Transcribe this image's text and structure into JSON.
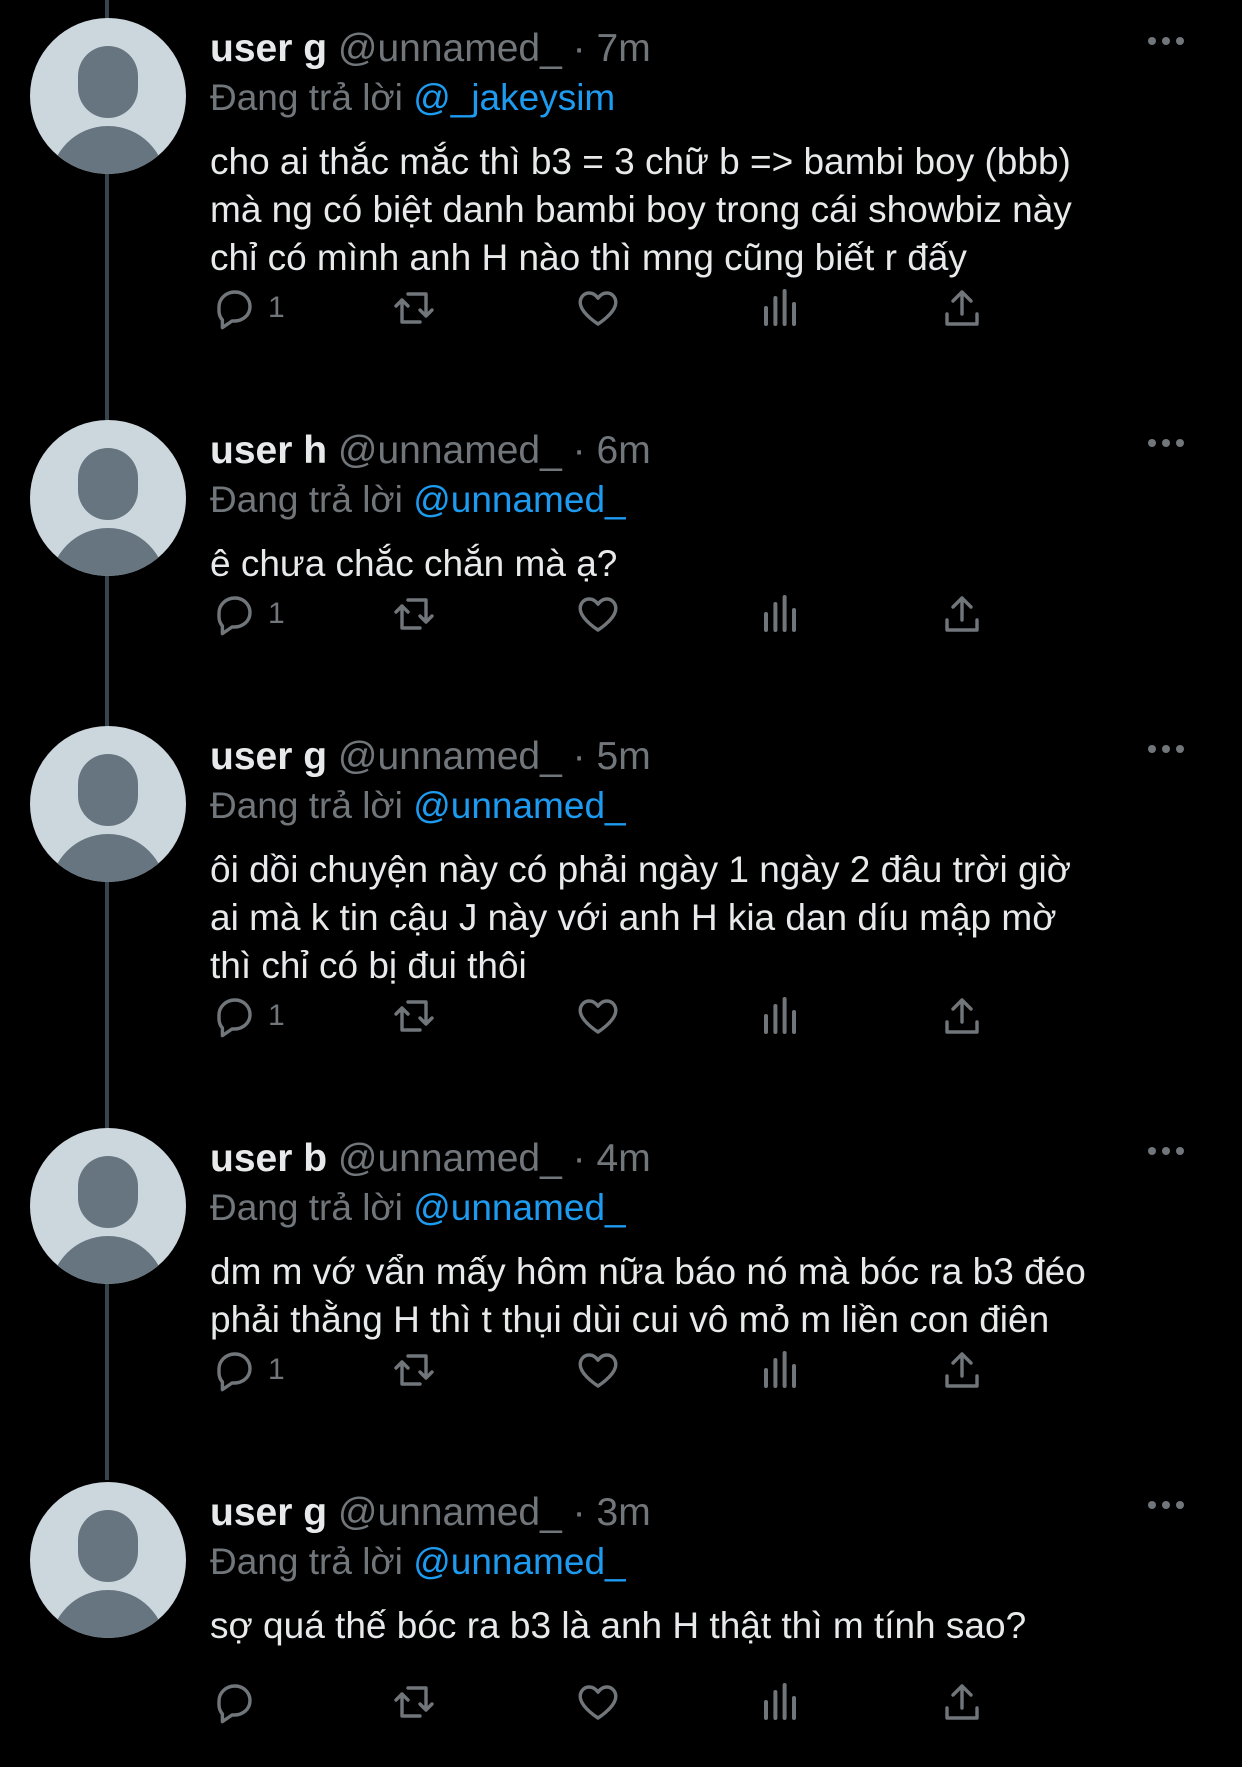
{
  "tweets": [
    {
      "name": "user g",
      "handle": "@unnamed_",
      "dot": "·",
      "time": "7m",
      "reply_prefix": "Đang trả lời",
      "reply_to": "@_jakeysim",
      "lines": [
        "cho ai thắc mắc thì b3 = 3 chữ b => bambi boy (bbb)",
        "mà ng có biệt danh bambi boy trong cái showbiz này",
        "chỉ có mình anh H nào thì mng cũng biết r đấy"
      ],
      "reply_count": "1"
    },
    {
      "name": "user h",
      "handle": "@unnamed_",
      "dot": "·",
      "time": "6m",
      "reply_prefix": "Đang trả lời",
      "reply_to": "@unnamed_",
      "lines": [
        "ê chưa chắc chắn mà ạ?"
      ],
      "reply_count": "1"
    },
    {
      "name": "user g",
      "handle": "@unnamed_",
      "dot": "·",
      "time": "5m",
      "reply_prefix": "Đang trả lời",
      "reply_to": "@unnamed_",
      "lines": [
        "ôi dồi chuyện này có phải ngày 1 ngày 2 đâu trời giờ",
        "ai mà k tin cậu J này với anh H kia dan díu mập mờ",
        "thì chỉ có bị đui thôi"
      ],
      "reply_count": "1"
    },
    {
      "name": "user b",
      "handle": "@unnamed_",
      "dot": "·",
      "time": "4m",
      "reply_prefix": "Đang trả lời",
      "reply_to": "@unnamed_",
      "lines": [
        "dm m vớ vẩn mấy hôm nữa báo nó mà bóc ra b3 đéo",
        "phải thằng H thì t thụi dùi cui vô mỏ m liền con điên"
      ],
      "reply_count": "1"
    },
    {
      "name": "user g",
      "handle": "@unnamed_",
      "dot": "·",
      "time": "3m",
      "reply_prefix": "Đang trả lời",
      "reply_to": "@unnamed_",
      "lines": [
        "sợ quá thế bóc ra b3 là anh H thật thì m tính sao?"
      ],
      "reply_count": ""
    }
  ],
  "icons": {
    "reply": "reply-icon",
    "retweet": "retweet-icon",
    "like": "like-icon",
    "views": "views-icon",
    "share": "share-icon",
    "more": "more-icon"
  },
  "colors": {
    "background": "#000000",
    "text": "#e7e9ea",
    "muted": "#71767b",
    "mention": "#1d9bf0",
    "avatar_bg": "#ccd6dd",
    "avatar_fg": "#66757f",
    "thread_line": "#38444d"
  }
}
